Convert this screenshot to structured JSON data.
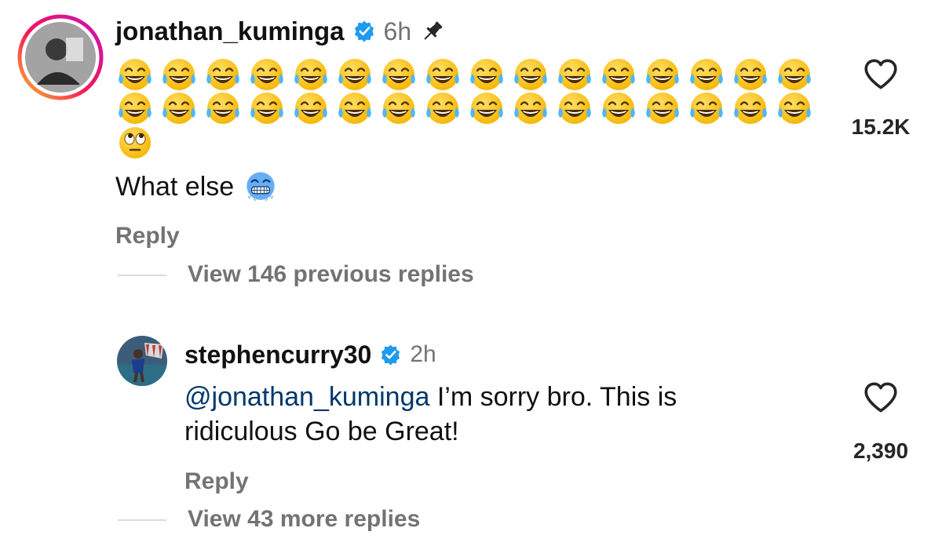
{
  "comment": {
    "username": "jonathan_kuminga",
    "time": "6h",
    "emoji_row1": [
      "laughing-tears",
      "laughing-tears",
      "laughing-tears",
      "laughing-tears",
      "laughing-tears",
      "laughing-tears",
      "laughing-tears",
      "laughing-tears",
      "laughing-tears",
      "laughing-tears",
      "laughing-tears",
      "laughing-tears",
      "laughing-tears",
      "laughing-tears",
      "laughing-tears",
      "laughing-tears"
    ],
    "emoji_row2": [
      "laughing-tears",
      "laughing-tears",
      "laughing-tears",
      "laughing-tears",
      "laughing-tears",
      "laughing-tears",
      "laughing-tears",
      "laughing-tears",
      "laughing-tears",
      "laughing-tears",
      "laughing-tears",
      "laughing-tears",
      "laughing-tears",
      "laughing-tears",
      "laughing-tears",
      "laughing-tears"
    ],
    "emoji_row3": [
      "eye-roll"
    ],
    "text": "What else",
    "text_emoji": "cold-face",
    "like_count": "15.2K",
    "reply_label": "Reply",
    "view_replies": "View 146 previous replies"
  },
  "reply": {
    "username": "stephencurry30",
    "time": "2h",
    "mention": "@jonathan_kuminga",
    "text_line1": " I’m sorry bro. This is",
    "text_line2": "ridiculous Go be Great!",
    "like_count": "2,390",
    "reply_label": "Reply",
    "view_replies": "View 43 more replies"
  },
  "colors": {
    "verified": "#1d9bf0",
    "mention": "#00376b",
    "muted": "#737373"
  }
}
